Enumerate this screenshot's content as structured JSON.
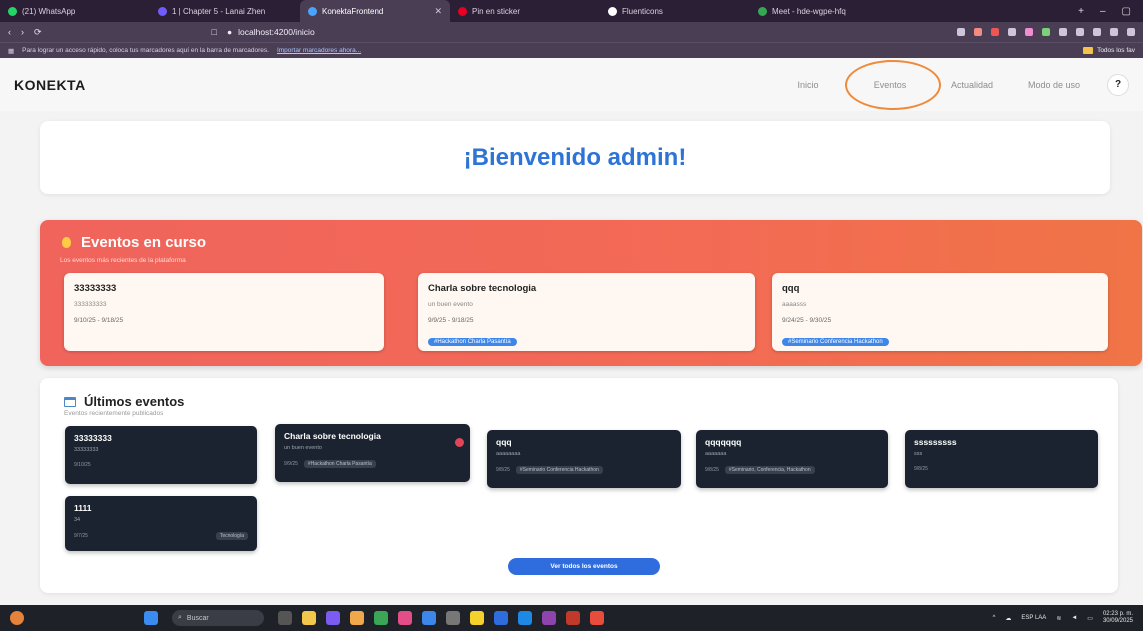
{
  "browser": {
    "tabs": [
      {
        "label": "(21) WhatsApp",
        "color": "#25d366"
      },
      {
        "label": "1 | Chapter 5 - Lanai Zhen",
        "color": "#6f5cff"
      },
      {
        "label": "KonektaFrontend",
        "color": "#4aa3ff",
        "active": true
      },
      {
        "label": "Pin en sticker",
        "color": "#e60023"
      },
      {
        "label": "Fluenticons",
        "color": "#ffffff"
      },
      {
        "label": "Meet - hde-wgpe-hfq",
        "color": "#34a853"
      }
    ],
    "url": "localhost:4200/inicio",
    "bookmarks_text": "Para lograr un acceso rápido, coloca tus marcadores aquí en la barra de marcadores.",
    "bookmarks_link": "Importar marcadores ahora...",
    "bookmarks_folder": "Todos los fav"
  },
  "navbar": {
    "brand": "KONEKTA",
    "links": [
      "Inicio",
      "Eventos",
      "Actualidad",
      "Modo de uso"
    ],
    "help": "?"
  },
  "welcome": "¡Bienvenido admin!",
  "current_events": {
    "title": "Eventos en curso",
    "subtitle": "Los eventos más recientes de la plataforma",
    "cards": [
      {
        "title": "33333333",
        "desc": "333333333",
        "dates": "9/10/25 - 9/18/25",
        "tag": ""
      },
      {
        "title": "Charla sobre tecnologia",
        "desc": "un buen evento",
        "dates": "9/9/25 - 9/18/25",
        "tag": "#Hackathon Charla Pasantía"
      },
      {
        "title": "qqq",
        "desc": "aaaasss",
        "dates": "9/24/25 - 9/30/25",
        "tag": "#Seminario Conferencia Hackathon"
      }
    ]
  },
  "latest_events": {
    "title": "Últimos eventos",
    "subtitle": "Eventos recientemente publicados",
    "cards": [
      {
        "title": "33333333",
        "desc": "33333333",
        "date": "9/10/25",
        "tag": ""
      },
      {
        "title": "Charla sobre tecnologia",
        "desc": "un buen evento",
        "date": "9/9/25",
        "tag": "#Hackathon Charla Pasantía"
      },
      {
        "title": "qqq",
        "desc": "aaaaaaaa",
        "date": "9/8/25",
        "tag": "#Seminario Conferencia Hackathon"
      },
      {
        "title": "qqqqqqq",
        "desc": "aaaaaaa",
        "date": "9/8/25",
        "tag": "#Seminario, Conferencia, Hackathon"
      },
      {
        "title": "sssssssss",
        "desc": "sss",
        "date": "9/8/25",
        "tag": ""
      },
      {
        "title": "1111",
        "desc": "34",
        "date": "9/7/25",
        "tag": "Tecnología"
      }
    ],
    "see_all": "Ver todos los eventos"
  },
  "taskbar": {
    "search": "Buscar",
    "lang": "ESP LAA",
    "time": "02:23 p. m.",
    "date": "30/09/2025"
  }
}
